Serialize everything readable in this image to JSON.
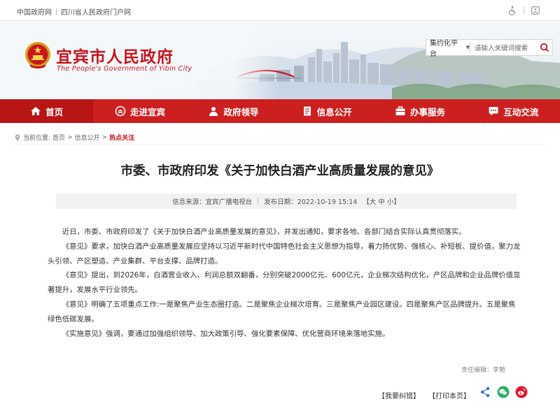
{
  "topbar": {
    "link1": "中国政府网",
    "link2": "四川省人民政府门户网",
    "icons": [
      "accessibility-icon",
      "elder-mode-icon"
    ]
  },
  "header": {
    "title": "宜宾市人民政府",
    "subtitle": "The People's Government of Yibin City"
  },
  "search": {
    "scope": "集约化平台",
    "placeholder": "请输入关键词搜索"
  },
  "nav": [
    {
      "label": "首页",
      "icon": "home-icon"
    },
    {
      "label": "走进宜宾",
      "icon": "emblem-icon"
    },
    {
      "label": "政府领导",
      "icon": "user-icon"
    },
    {
      "label": "信息公开",
      "icon": "document-icon"
    },
    {
      "label": "办事服务",
      "icon": "briefcase-icon"
    },
    {
      "label": "互动交流",
      "icon": "chat-icon"
    }
  ],
  "breadcrumb": {
    "prefix": "当前位置:",
    "items": [
      "首页",
      "信息公开",
      "热点关注"
    ],
    "separator": ">"
  },
  "article": {
    "title": "市委、市政府印发《关于加快白酒产业高质量发展的意见》",
    "source_label": "信息来源：",
    "source": "宜宾广播电视台",
    "date_label": "发布日期：",
    "date": "2022-10-19 15:14",
    "font_sizes": "【大 中 小】",
    "paragraphs": [
      "近日，市委、市政府印发了《关于加快白酒产业高质量发展的意见》，并发出通知，要求各地、各部门结合实际认真贯彻落实。",
      "《意见》要求，加快白酒产业高质量发展应坚持以习近平新时代中国特色社会主义思想为指导，着力扬优势、强核心、补短板、提价值，聚力龙头引领、产区塑造、产业集群、平台支撑、品牌打造。",
      "《意见》提出，到2026年，白酒营业收入、利润总额双翻番，分别突破2000亿元、600亿元，企业梯次结构优化，产区品牌和企业品牌价值显著提升，发展水平行业领先。",
      "《意见》明确了五项重点工作:一是聚焦产业生态圈打造。二是聚焦企业梯次培育。三是聚焦产业园区建设。四是聚焦产区品牌提升。五是聚焦绿色低碳发展。",
      "《实施意见》强调，要通过加强组织领导、加大政策引导、强化要素保障、优化营商环境来落地实施。"
    ],
    "editor": "责任编辑：李勉"
  },
  "actions": {
    "correction": "【我要纠错】",
    "print": "【打印本页】"
  },
  "share": {
    "colors": {
      "share": "#3b6fb6",
      "wechat": "#2aae67",
      "weibo": "#e6162d"
    }
  },
  "colors": {
    "brand_red": "#c8161d",
    "nav_red": "#cc1f1f"
  }
}
